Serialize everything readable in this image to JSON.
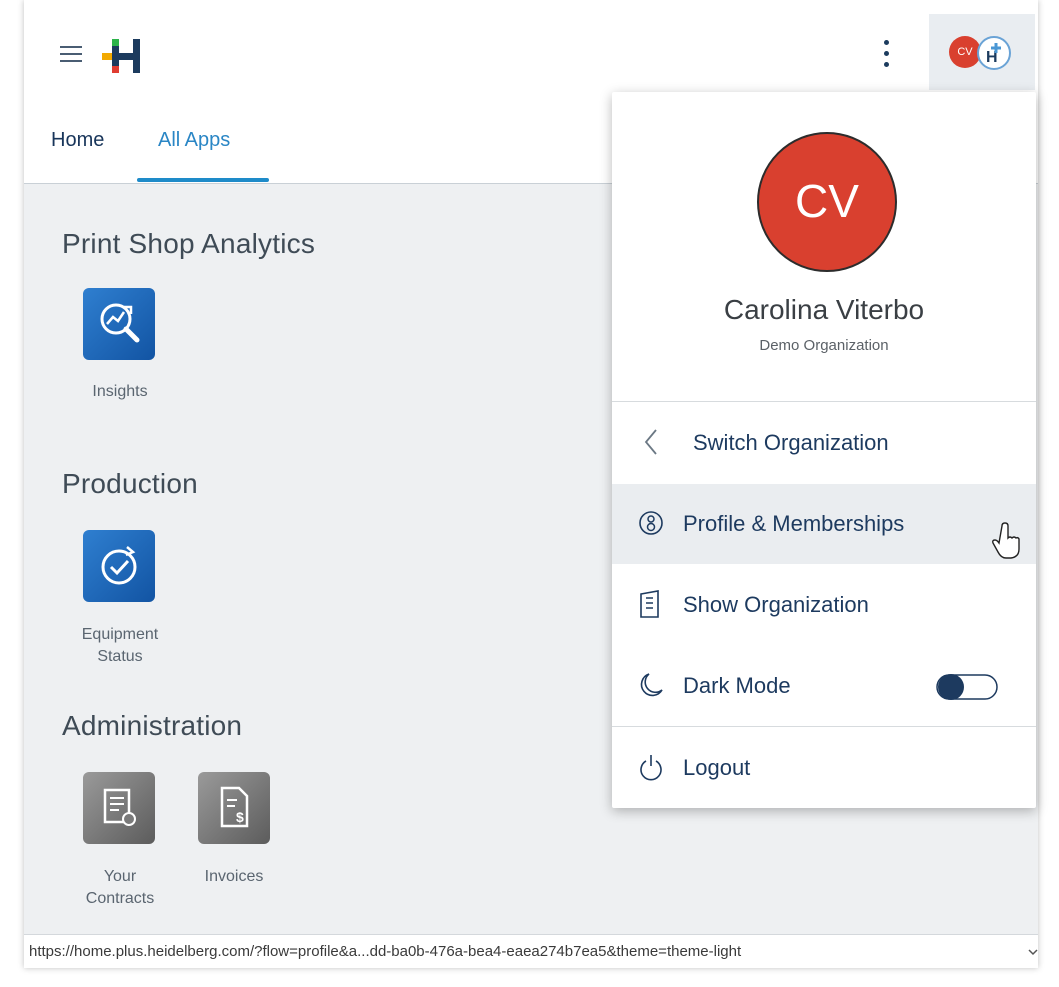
{
  "header": {
    "logo": "heidelberg-plus-logo",
    "account_initials": "CV"
  },
  "tabs": [
    {
      "label": "Home",
      "active": false
    },
    {
      "label": "All Apps",
      "active": true
    }
  ],
  "sections": [
    {
      "title": "Print Shop Analytics",
      "apps": [
        {
          "label": "Insights",
          "icon": "insights-icon",
          "tile": "blue"
        }
      ]
    },
    {
      "title": "Production",
      "apps": [
        {
          "label_lines": [
            "Equipment",
            "Status"
          ],
          "icon": "equipment-status-icon",
          "tile": "blue"
        }
      ]
    },
    {
      "title": "Administration",
      "apps": [
        {
          "label_lines": [
            "Your",
            "Contracts"
          ],
          "icon": "contracts-icon",
          "tile": "grey"
        },
        {
          "label": "Invoices",
          "icon": "invoices-icon",
          "tile": "grey"
        }
      ]
    }
  ],
  "account_menu": {
    "avatar_initials": "CV",
    "user_name": "Carolina Viterbo",
    "organization": "Demo Organization",
    "items": [
      {
        "label": "Switch Organization",
        "icon": "chevron-left-icon"
      },
      {
        "label": "Profile & Memberships",
        "icon": "profile-icon",
        "hovered": true
      },
      {
        "label": "Show Organization",
        "icon": "building-icon"
      },
      {
        "label": "Dark Mode",
        "icon": "moon-icon",
        "toggle_on": true
      },
      {
        "label": "Logout",
        "icon": "power-icon"
      }
    ]
  },
  "status_bar": {
    "url": "https://home.plus.heidelberg.com/?flow=profile&a...dd-ba0b-476a-bea4-eaea274b7ea5&theme=theme-light"
  },
  "colors": {
    "accent": "#2a86c5",
    "navy": "#1d3a5f",
    "avatar_red": "#d9402f",
    "content_bg": "#eef0f2",
    "tile_blue": "#1f6ec0"
  }
}
